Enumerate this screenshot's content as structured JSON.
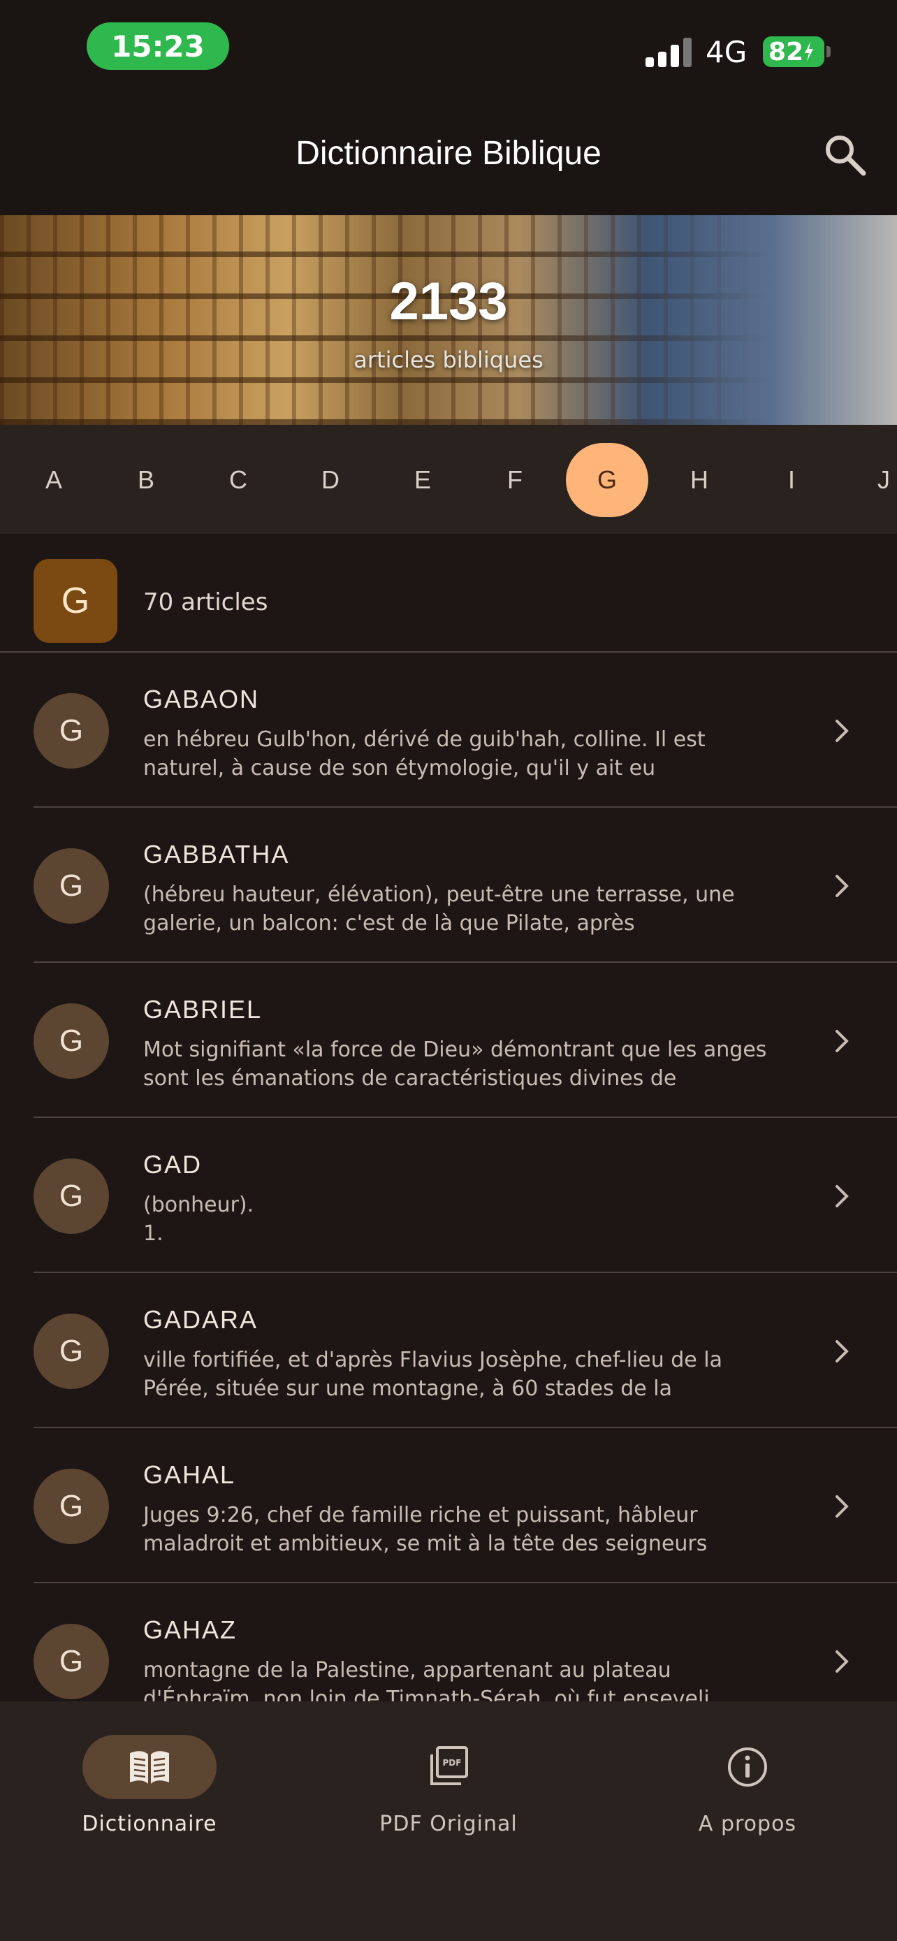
{
  "status_bar": {
    "time": "15:23",
    "network": "4G",
    "battery": "82"
  },
  "header": {
    "title": "Dictionnaire Biblique",
    "search_icon": "search-icon"
  },
  "hero": {
    "count": "2133",
    "subtitle": "articles bibliques"
  },
  "alphabet": {
    "letters": [
      "A",
      "B",
      "C",
      "D",
      "E",
      "F",
      "G",
      "H",
      "I",
      "J"
    ],
    "selected": "G"
  },
  "group": {
    "letter": "G",
    "count_label": "70 articles"
  },
  "articles": [
    {
      "initial": "G",
      "title": "GABAON",
      "desc": "en hébreu Gulb'hon, dérivé de guib'hah, colline. Il est\nnaturel, à cause de son étymologie, qu'il y ait eu"
    },
    {
      "initial": "G",
      "title": "GABBATHA",
      "desc": "(hébreu hauteur, élévation), peut-être une terrasse, une\ngalerie, un balcon: c'est de là que Pilate, après"
    },
    {
      "initial": "G",
      "title": "GABRIEL",
      "desc": "Mot signifiant «la force de Dieu» démontrant que les anges\nsont les émanations de caractéristiques divines de"
    },
    {
      "initial": "G",
      "title": "GAD",
      "desc": "(bonheur).\n1."
    },
    {
      "initial": "G",
      "title": "GADARA",
      "desc": "ville fortifiée, et d'après Flavius Josèphe, chef-lieu de la\nPérée, située sur une montagne, à 60 stades de la"
    },
    {
      "initial": "G",
      "title": "GAHAL",
      "desc": "Juges 9:26, chef de famille riche et puissant, hâbleur\nmaladroit et ambitieux, se mit à la tête des seigneurs"
    },
    {
      "initial": "G",
      "title": "GAHAZ",
      "desc": "montagne de la Palestine, appartenant au plateau\nd'Éphraïm, non loin de Timnath-Sérah, où fut enseveli"
    }
  ],
  "bottom_nav": {
    "items": [
      {
        "label": "Dictionnaire",
        "icon": "book-icon",
        "active": true
      },
      {
        "label": "PDF Original",
        "icon": "pdf-icon",
        "active": false
      },
      {
        "label": "A propos",
        "icon": "info-icon",
        "active": false
      }
    ]
  },
  "colors": {
    "background": "#1d1614",
    "accent": "#ffb57a",
    "avatar": "#5c4531",
    "group_badge": "#7a4a12",
    "status_green": "#2fb84d"
  }
}
